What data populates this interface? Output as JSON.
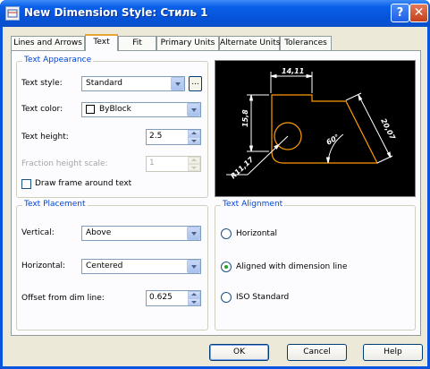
{
  "window": {
    "title": "New Dimension Style: Стиль 1"
  },
  "tabs": [
    {
      "label": "Lines and Arrows",
      "active": false
    },
    {
      "label": "Text",
      "active": true
    },
    {
      "label": "Fit",
      "active": false
    },
    {
      "label": "Primary Units",
      "active": false
    },
    {
      "label": "Alternate Units",
      "active": false
    },
    {
      "label": "Tolerances",
      "active": false
    }
  ],
  "text_appearance": {
    "title": "Text Appearance",
    "style_label": "Text style:",
    "style_value": "Standard",
    "browse_label": "...",
    "color_label": "Text color:",
    "color_value": "ByBlock",
    "height_label": "Text height:",
    "height_value": "2.5",
    "fraction_label": "Fraction height scale:",
    "fraction_value": "1",
    "frame_label": "Draw frame around text",
    "frame_checked": false
  },
  "preview": {
    "dim_top": "14,11",
    "dim_left": "15,8",
    "dim_right": "20,07",
    "dim_radius": "R11,17",
    "dim_angle": "60°",
    "line_color": "#ffffff",
    "shape_color": "#ff9c00"
  },
  "text_placement": {
    "title": "Text Placement",
    "vertical_label": "Vertical:",
    "vertical_value": "Above",
    "horizontal_label": "Horizontal:",
    "horizontal_value": "Centered",
    "offset_label": "Offset from dim line:",
    "offset_value": "0.625"
  },
  "text_alignment": {
    "title": "Text Alignment",
    "options": [
      {
        "label": "Horizontal",
        "selected": false
      },
      {
        "label": "Aligned with dimension line",
        "selected": true
      },
      {
        "label": "ISO Standard",
        "selected": false
      }
    ]
  },
  "buttons": {
    "ok": "OK",
    "cancel": "Cancel",
    "help": "Help"
  }
}
